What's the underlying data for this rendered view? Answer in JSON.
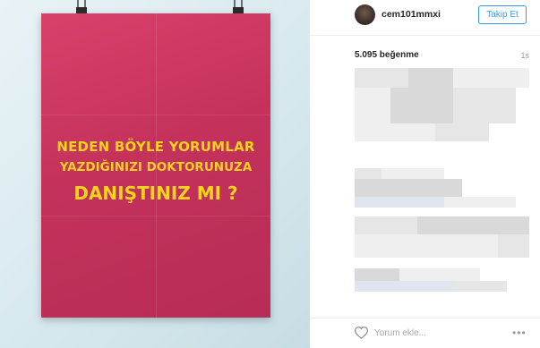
{
  "post": {
    "poster_lines": [
      "NEDEN BÖYLE YORUMLAR",
      "YAZDIĞINIZI DOKTORUNUZA",
      "DANIŞTINIZ MI ?"
    ],
    "poster_color": "#c4325c",
    "text_color": "#f7d21f"
  },
  "header": {
    "username": "cem101mmxi",
    "follow_label": "Takip Et"
  },
  "stats": {
    "likes": "5.095 beğenme",
    "time": "1s"
  },
  "footer": {
    "comment_placeholder": "Yorum ekle...",
    "more": "•••"
  },
  "icons": {
    "like": "heart-icon",
    "more": "more-options-icon"
  }
}
